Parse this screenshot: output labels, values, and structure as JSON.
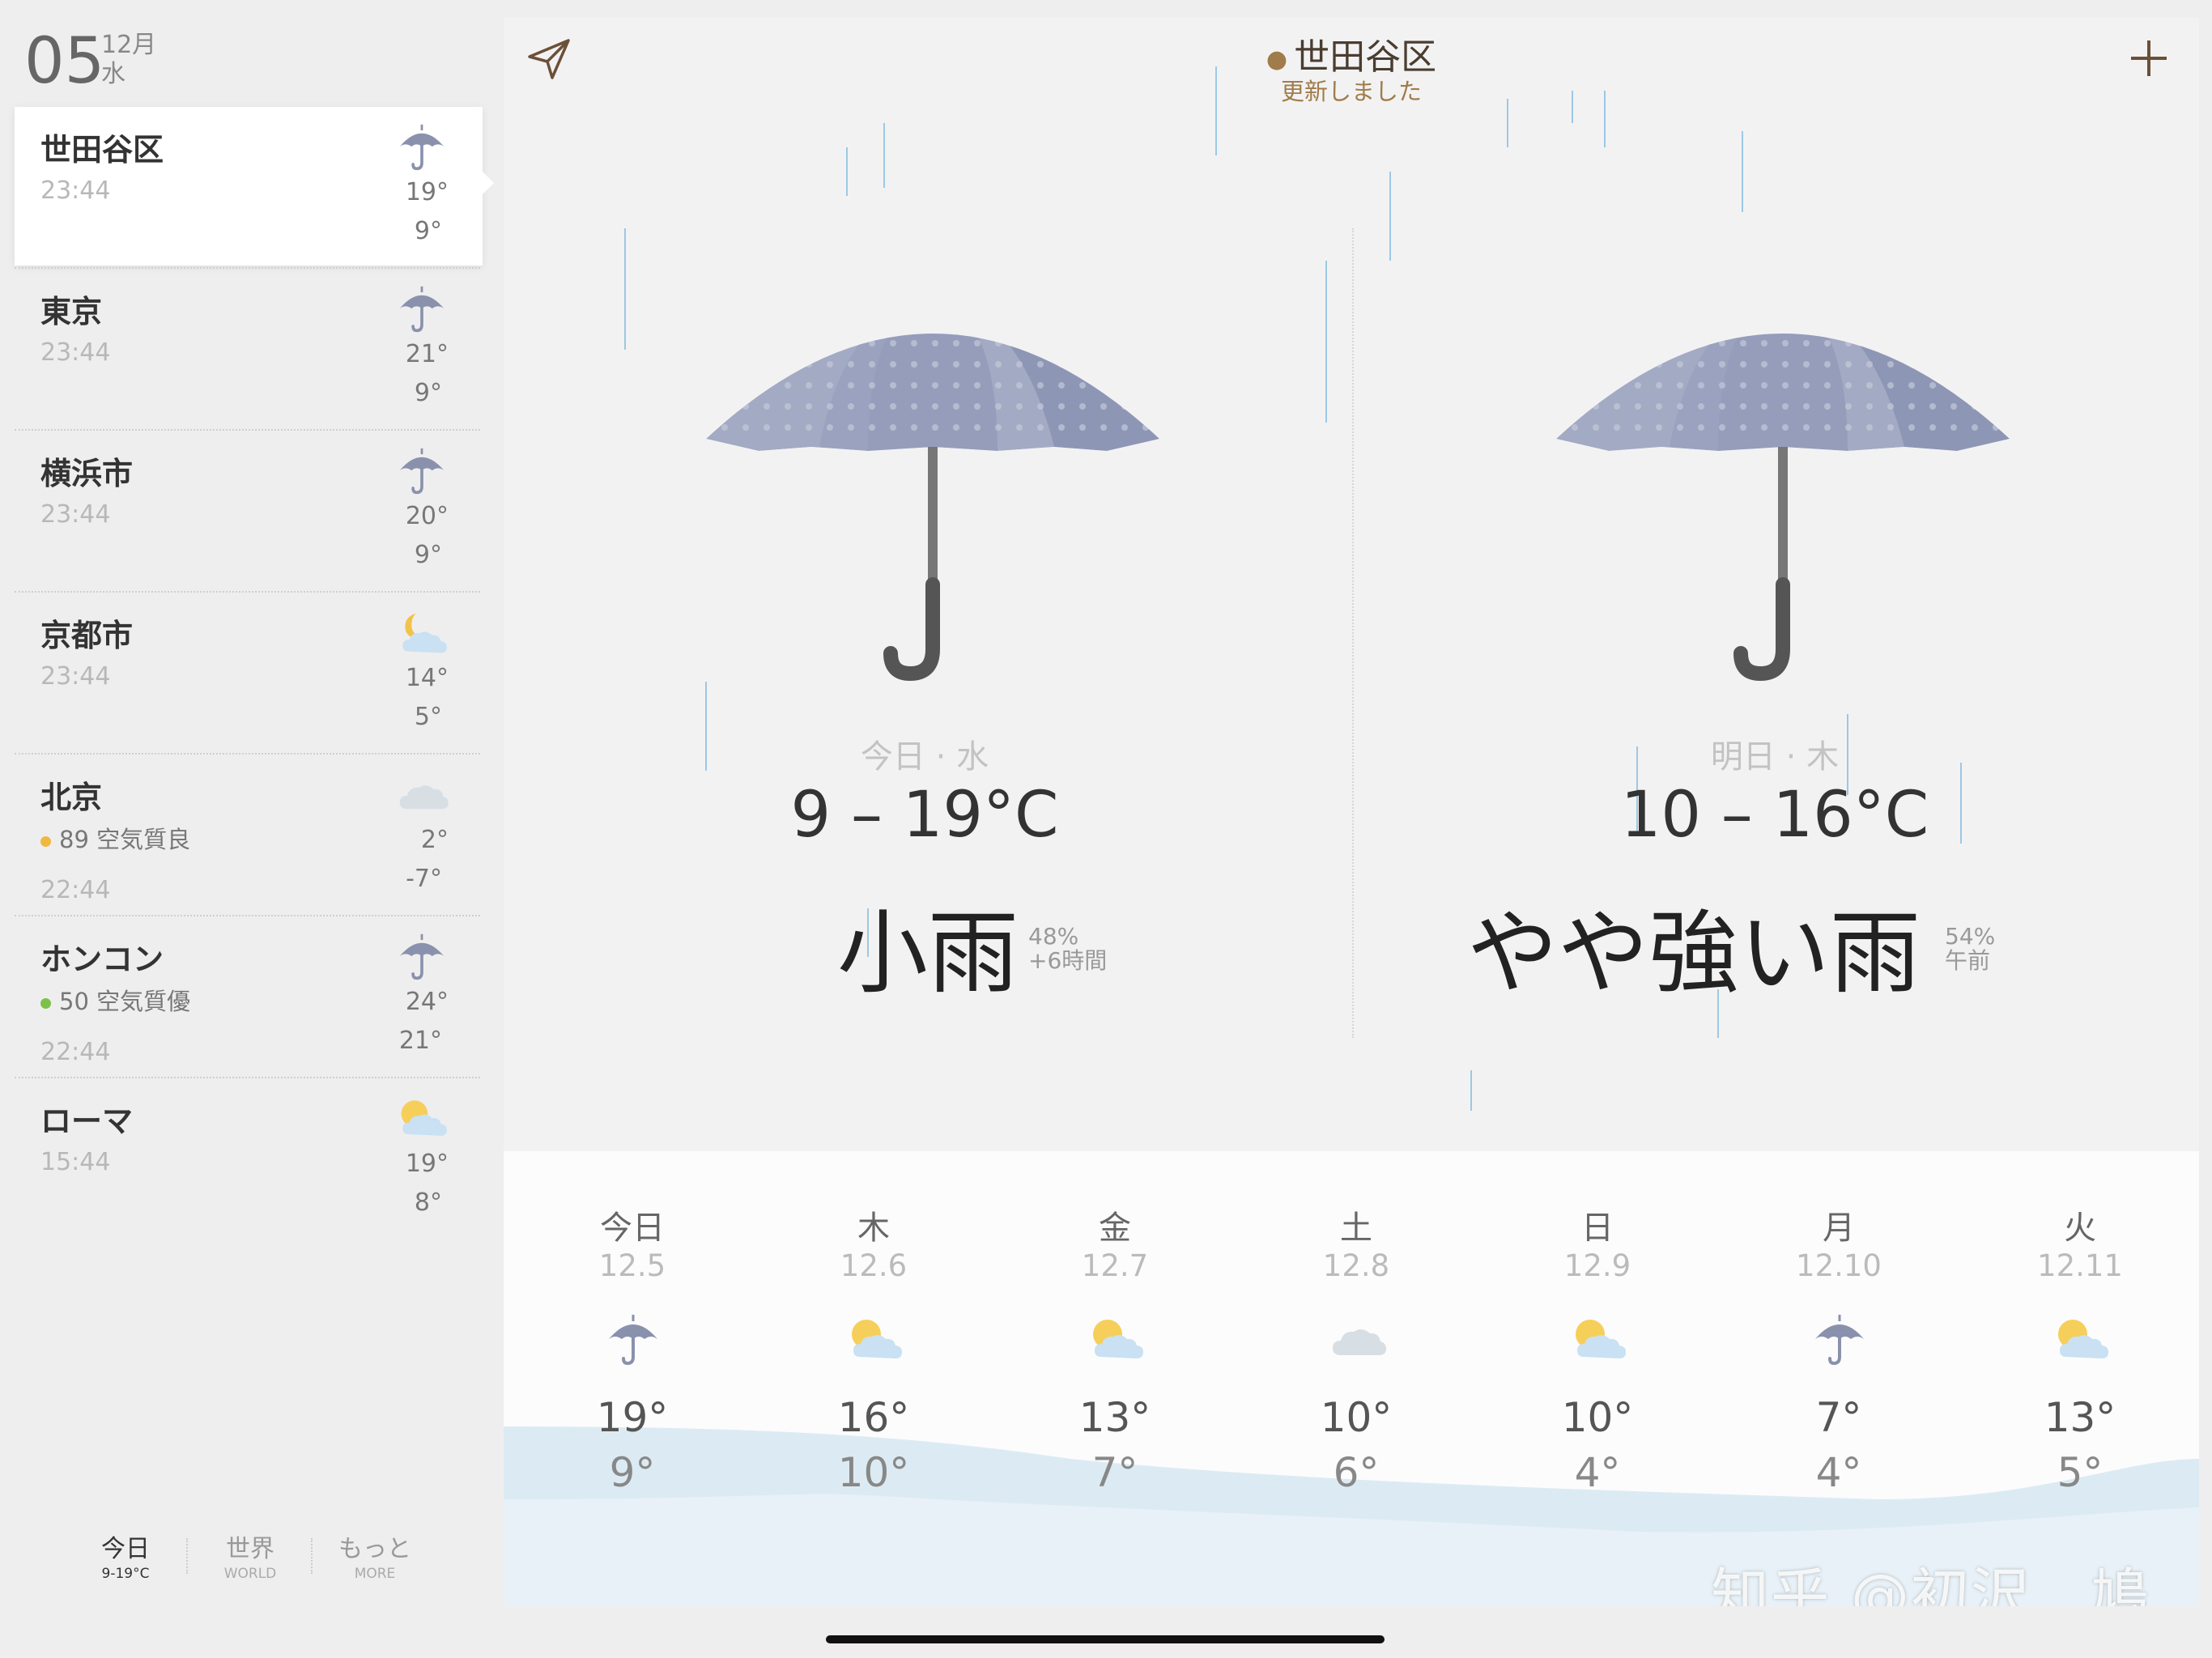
{
  "date": {
    "day": "05",
    "month": "12月",
    "weekday": "水"
  },
  "cities": [
    {
      "name": "世田谷区",
      "time": "23:44",
      "high": "19°",
      "low": "9°",
      "icon": "umbrella-icon",
      "selected": true
    },
    {
      "name": "東京",
      "time": "23:44",
      "high": "21°",
      "low": "9°",
      "icon": "umbrella-icon"
    },
    {
      "name": "横浜市",
      "time": "23:44",
      "high": "20°",
      "low": "9°",
      "icon": "umbrella-icon"
    },
    {
      "name": "京都市",
      "time": "23:44",
      "high": "14°",
      "low": "5°",
      "icon": "moon-cloud-icon"
    },
    {
      "name": "北京",
      "aqi": "89 空気質良",
      "aqi_color": "#f0b840",
      "time": "22:44",
      "high": "2°",
      "low": "-7°",
      "icon": "cloud-icon"
    },
    {
      "name": "ホンコン",
      "aqi": "50 空気質優",
      "aqi_color": "#7cc24a",
      "time": "22:44",
      "high": "24°",
      "low": "21°",
      "icon": "umbrella-icon"
    },
    {
      "name": "ローマ",
      "time": "15:44",
      "high": "19°",
      "low": "8°",
      "icon": "sun-cloud-icon"
    }
  ],
  "tabs": [
    {
      "label": "今日",
      "sub": "9-19°C",
      "active": true
    },
    {
      "label": "世界",
      "sub": "WORLD"
    },
    {
      "label": "もっと",
      "sub": "MORE"
    }
  ],
  "header": {
    "location": "世田谷区",
    "status": "更新しました"
  },
  "today": {
    "label": "今日 · 水",
    "temp": "9 – 19°C",
    "condition": "小雨",
    "meta1": "48%",
    "meta2": "+6時間"
  },
  "tomorrow": {
    "label": "明日 · 木",
    "temp": "10 – 16°C",
    "condition": "やや強い雨",
    "meta1": "54%",
    "meta2": "午前"
  },
  "forecast": [
    {
      "day": "今日",
      "date": "12.5",
      "high": "19°",
      "low": "9°",
      "icon": "umbrella-icon"
    },
    {
      "day": "木",
      "date": "12.6",
      "high": "16°",
      "low": "10°",
      "icon": "sun-cloud-icon"
    },
    {
      "day": "金",
      "date": "12.7",
      "high": "13°",
      "low": "7°",
      "icon": "sun-cloud-icon"
    },
    {
      "day": "土",
      "date": "12.8",
      "high": "10°",
      "low": "6°",
      "icon": "cloud-icon"
    },
    {
      "day": "日",
      "date": "12.9",
      "high": "10°",
      "low": "4°",
      "icon": "sun-cloud-icon"
    },
    {
      "day": "月",
      "date": "12.10",
      "high": "7°",
      "low": "4°",
      "icon": "umbrella-icon"
    },
    {
      "day": "火",
      "date": "12.11",
      "high": "13°",
      "low": "5°",
      "icon": "sun-cloud-icon"
    }
  ],
  "watermark": "知乎 @初沢　鳩",
  "colors": {
    "accent": "#a07c4a",
    "umbrella": "#8a91ad",
    "rain": "#9cc8e4",
    "wave": "#dcebf3"
  }
}
